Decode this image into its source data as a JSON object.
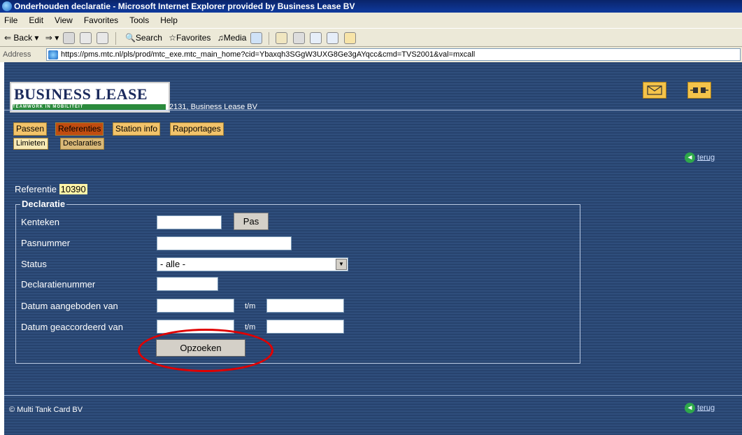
{
  "window": {
    "title": "Onderhouden declaratie - Microsoft Internet Explorer provided by Business Lease BV"
  },
  "menu": {
    "items": [
      "File",
      "Edit",
      "View",
      "Favorites",
      "Tools",
      "Help"
    ]
  },
  "toolbar": {
    "back": "Back",
    "search": "Search",
    "favorites": "Favorites",
    "media": "Media"
  },
  "address": {
    "label": "Address",
    "url": "https://pms.mtc.nl/pls/prod/mtc_exe.mtc_main_home?cid=Ybaxqh3SGgW3UXG8Ge3gAYqcc&cmd=TVS2001&val=mxcall"
  },
  "header": {
    "logo_main": "BUSINESS LEASE",
    "logo_sub": "TEAMWORK IN MOBILITEIT",
    "company": "2131, Business Lease BV"
  },
  "nav": {
    "tabs": [
      "Passen",
      "Referenties",
      "Station info",
      "Rapportages"
    ],
    "active_tab": "Referenties",
    "subtabs": [
      "Limieten",
      "Declaraties"
    ],
    "active_subtab": "Declaraties"
  },
  "links": {
    "back": "terug"
  },
  "reference": {
    "label": "Referentie",
    "value": "10390"
  },
  "form": {
    "legend": "Declaratie",
    "kenteken_label": "Kenteken",
    "pas_button": "Pas",
    "pasnummer_label": "Pasnummer",
    "status_label": "Status",
    "status_value": "- alle -",
    "declaratienummer_label": "Declaratienummer",
    "aangeboden_label": "Datum aangeboden van",
    "geaccordeerd_label": "Datum geaccordeerd van",
    "tm_label": "t/m",
    "search_button": "Opzoeken"
  },
  "footer": {
    "copyright": "© Multi Tank Card BV"
  },
  "colors": {
    "page_bg": "#2b4a77",
    "active_tab": "#c04c10",
    "tab": "#f2c36a",
    "highlight_ellipse": "#e00000"
  }
}
